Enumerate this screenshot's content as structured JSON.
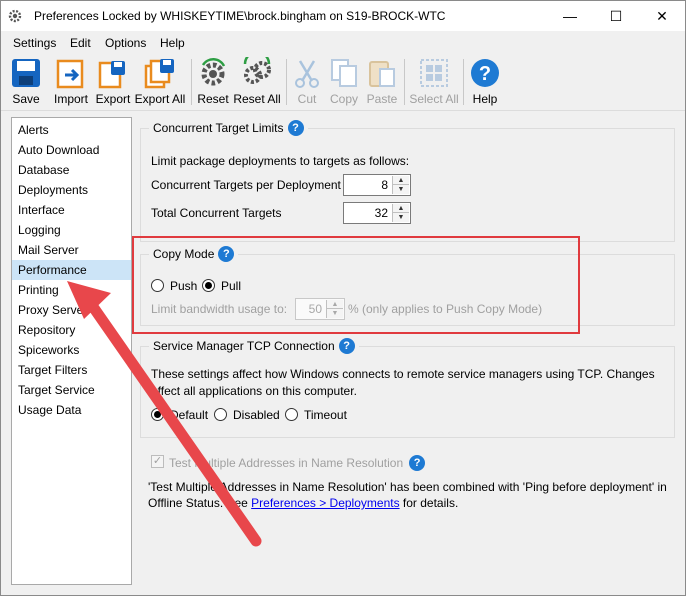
{
  "window": {
    "title": "Preferences Locked by WHISKEYTIME\\brock.bingham on S19-BROCK-WTC",
    "minimize_glyph": "—",
    "maximize_glyph": "☐",
    "close_glyph": "✕"
  },
  "menu": [
    "Settings",
    "Edit",
    "Options",
    "Help"
  ],
  "toolbar": [
    {
      "label": "Save",
      "icon": "save-icon",
      "enabled": true
    },
    {
      "label": "Import",
      "icon": "import-icon",
      "enabled": true
    },
    {
      "label": "Export",
      "icon": "export-icon",
      "enabled": true
    },
    {
      "label": "Export All",
      "icon": "export-all-icon",
      "enabled": true
    },
    {
      "label": "Reset",
      "icon": "reset-gear-icon",
      "enabled": true
    },
    {
      "label": "Reset All",
      "icon": "reset-all-gear-icon",
      "enabled": true
    },
    {
      "label": "Cut",
      "icon": "cut-icon",
      "enabled": false
    },
    {
      "label": "Copy",
      "icon": "copy-icon",
      "enabled": false
    },
    {
      "label": "Paste",
      "icon": "paste-icon",
      "enabled": false
    },
    {
      "label": "Select All",
      "icon": "select-all-icon",
      "enabled": false
    },
    {
      "label": "Help",
      "icon": "help-icon",
      "enabled": true
    }
  ],
  "sidebar": {
    "items": [
      "Alerts",
      "Auto Download",
      "Database",
      "Deployments",
      "Interface",
      "Logging",
      "Mail Server",
      "Performance",
      "Printing",
      "Proxy Server",
      "Repository",
      "Spiceworks",
      "Target Filters",
      "Target Service",
      "Usage Data"
    ],
    "selected": "Performance"
  },
  "concurrent": {
    "title": "Concurrent Target Limits",
    "description": "Limit package deployments to targets as follows:",
    "per_deployment_label": "Concurrent Targets per Deployment",
    "per_deployment_value": "8",
    "total_label": "Total Concurrent Targets",
    "total_value": "32"
  },
  "copy_mode": {
    "title": "Copy Mode",
    "push_label": "Push",
    "pull_label": "Pull",
    "selected": "Pull",
    "bandwidth_label": "Limit bandwidth usage to:",
    "bandwidth_value": "50",
    "bandwidth_suffix": "% (only applies to Push Copy Mode)"
  },
  "tcp": {
    "title": "Service Manager TCP Connection",
    "description_line1": "These settings affect how Windows connects to remote service managers using TCP. Changes",
    "description_line2": "affect all applications on this computer.",
    "options": [
      "Default",
      "Disabled",
      "Timeout"
    ],
    "selected": "Default"
  },
  "test_multiple": {
    "label": "Test Multiple Addresses in Name Resolution",
    "checked": true,
    "note_line1": "'Test Multiple Addresses in Name Resolution' has been combined with 'Ping before deployment' in",
    "note_line2_prefix": "Offline Status. See ",
    "note_link": "Preferences > Deployments",
    "note_line2_suffix": " for details."
  },
  "annotation_color": "#e03a3e",
  "accent_color": "#1e7ad3"
}
